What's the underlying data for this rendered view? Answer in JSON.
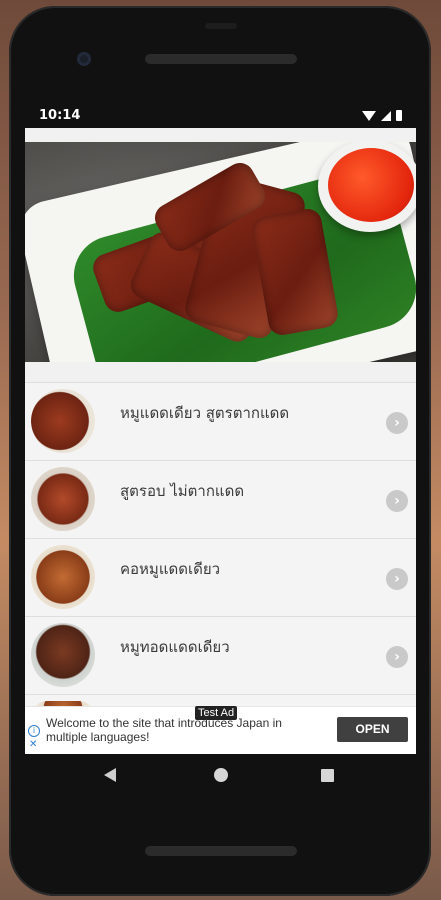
{
  "status_bar": {
    "time": "10:14"
  },
  "hero": {
    "description": ""
  },
  "menu": {
    "items": [
      {
        "title": "หมูแดดเดียว สูตรตากแดด",
        "icon": "chevron-right-icon"
      },
      {
        "title": "สูตรอบ ไม่ตากแดด",
        "icon": "chevron-right-icon"
      },
      {
        "title": "คอหมูแดดเดียว",
        "icon": "chevron-right-icon"
      },
      {
        "title": "หมูทอดแดดเดียว",
        "icon": "chevron-right-icon"
      }
    ]
  },
  "ad": {
    "badge": "Test Ad",
    "text": "Welcome to the site that introduces Japan in multiple languages!",
    "cta": "OPEN"
  },
  "colors": {
    "screen_bg": "#f1f1f1",
    "text": "#3a3a3a",
    "chevron": "#c9c9c9",
    "ad_button": "#404040",
    "ad_icon": "#2e7dd1"
  }
}
